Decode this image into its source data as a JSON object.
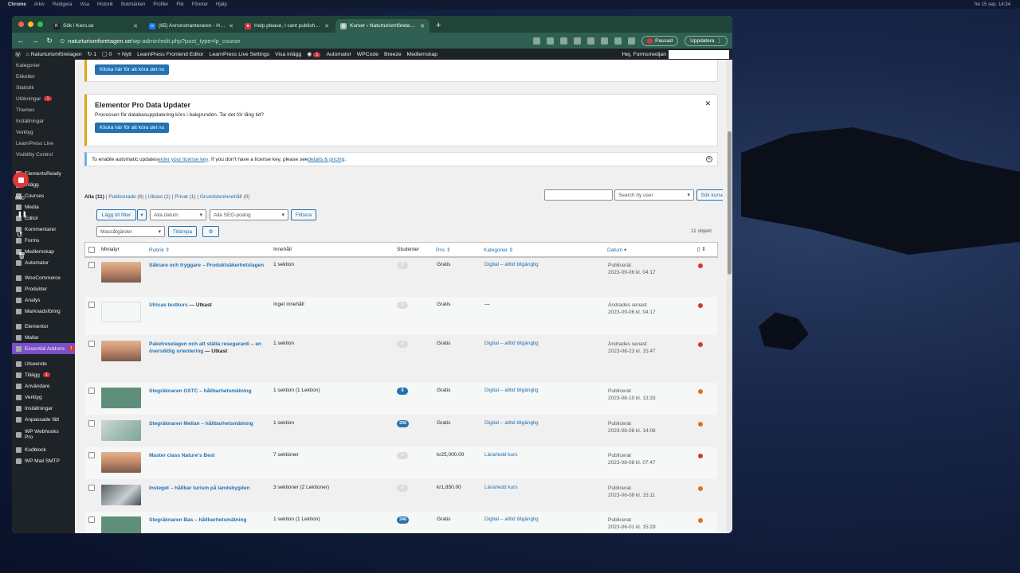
{
  "mac_menu": [
    "Chrome",
    "Arkiv",
    "Redigera",
    "Visa",
    "Historik",
    "Bokmärken",
    "Profiler",
    "Flik",
    "Fönster",
    "Hjälp"
  ],
  "mac_clock": "fre 15 sep. 14:34",
  "tabs": [
    {
      "title": "Sök i Kero.se",
      "icon": "K",
      "color": "#1d2327"
    },
    {
      "title": "(65) Annonshanteraren - Ham",
      "icon": "∞",
      "color": "#1877f2"
    },
    {
      "title": "Help please, I cant publish co",
      "icon": "●",
      "color": "#d63638"
    },
    {
      "title": "Kurser ‹ Naturturismföretagen",
      "icon": "◍",
      "color": "#9fb9b0"
    }
  ],
  "url": {
    "host": "naturturismforetagen.se",
    "path": "/wp-admin/edit.php?post_type=lp_course"
  },
  "browser_buttons": {
    "paused": "Pausad",
    "update": "Uppdatera"
  },
  "adminbar": {
    "site": "Naturturismföretagen",
    "updates": "1",
    "comments": "0",
    "new": "Nytt",
    "items": [
      "LearnPress Frontend Editor",
      "LearnPress Live Settings",
      "Visa inlägg"
    ],
    "notif": "1",
    "items2": [
      "Automator",
      "WPCode",
      "Breeze",
      "Medlemskap"
    ],
    "greeting": "Hej, Formsmedjan"
  },
  "sidebar": {
    "subitems": [
      "Kategorier",
      "Etiketter",
      "Statistik",
      "Utökningar",
      "Themes",
      "Inställningar",
      "Verktyg",
      "LearnPress Live",
      "Visibility Control"
    ],
    "sub_badge": "1",
    "items": [
      "ElementsReady",
      "Inlägg",
      "Courses",
      "Media",
      "Editor",
      "Kommentarer",
      "Forms",
      "Medlemskap",
      "Automator",
      "WooCommerce",
      "Produkter",
      "Analys",
      "Marknadsföring",
      "Elementor",
      "Mallar",
      "Essential Addons",
      "Utseende",
      "Tillägg",
      "Användare",
      "Verktyg",
      "Inställningar",
      "Anpassade fält",
      "WP Webhooks Pro",
      "Kodblock",
      "WP Mail SMTP"
    ],
    "essential_badge": "1",
    "tillagg_badge": "1"
  },
  "recorder": {
    "time": "0:00"
  },
  "notice1": {
    "button": "Klicka här för att köra det nu"
  },
  "notice2": {
    "title": "Elementor Pro Data Updater",
    "text": "Processen för databasuppdatering körs i bakgrunden. Tar det för lång tid?",
    "button": "Klicka här för att köra det nu"
  },
  "license": {
    "pre": "To enable automatic updates ",
    "link1": "enter your license key",
    "mid": ". If you don't have a license key, please see ",
    "link2": "details & pricing",
    "post": "."
  },
  "filters": {
    "all": "Alla",
    "all_count": "(11)",
    "published": "Publicerade",
    "published_count": "(8)",
    "draft": "Utkast",
    "draft_count": "(2)",
    "private": "Privat",
    "private_count": "(1)",
    "drafts_content": "Grundsteninnehåll",
    "drafts_content_count": "(0)"
  },
  "search": {
    "user_placeholder": "Search by user",
    "button": "Sök kurser"
  },
  "toolbar": {
    "add_filter": "Lägg till filter",
    "dates": "Alla datum",
    "seo": "Alla SEO-poäng",
    "filter": "Filtrera",
    "bulk": "Massåtgärder",
    "apply": "Tillämpa",
    "count": "11 objekt"
  },
  "columns": {
    "thumb": "Miniatyr",
    "title": "Rubrik",
    "content": "Innehåll",
    "students": "Studenter",
    "price": "Pris",
    "categories": "Kategorier",
    "date": "Datum"
  },
  "colors": {
    "red": "#d63638",
    "orange": "#e2701f",
    "blue": "#2271b1"
  },
  "rows": [
    {
      "title": "Säkrare och tryggare – Produktsäkerhetslagen",
      "draft": "",
      "content": "1 sektion",
      "students": "0",
      "price": "Gratis",
      "category": "Digital – alltid tillgänglig",
      "date1": "Publicerat",
      "date2": "2023-09-06 kl. 04:17",
      "dot": "red",
      "thumb": "sunset"
    },
    {
      "title": "Ulricas testkurs",
      "draft": " — Utkast",
      "content": "Inget innehåll",
      "students": "0",
      "price": "Gratis",
      "category": "—",
      "date1": "Ändrades senast",
      "date2": "2023-09-06 kl. 04:17",
      "dot": "red",
      "thumb": "empty"
    },
    {
      "title": "Paketreselagen och att ställa resegaranti – en översiktlig orientering",
      "draft": " — Utkast",
      "content": "1 sektion",
      "students": "0",
      "price": "Gratis",
      "category": "Digital – alltid tillgänglig",
      "date1": "Ändrades senast",
      "date2": "2023-08-23 kl. 15:47",
      "dot": "red",
      "thumb": "sunset"
    },
    {
      "title": "Stegräknaren GSTC – hållbarhetsmätning",
      "draft": "",
      "content": "1 sektion (1 Lektion)",
      "students": "9",
      "price": "Gratis",
      "category": "Digital – alltid tillgänglig",
      "date1": "Publicerat",
      "date2": "2023-08-10 kl. 13:33",
      "dot": "orange",
      "thumb": "green"
    },
    {
      "title": "Stegräknaren Mellan – hållbarhetsmätning",
      "draft": "",
      "content": "1 sektion",
      "students": "235",
      "price": "Gratis",
      "category": "Digital – alltid tillgänglig",
      "date1": "Publicerat",
      "date2": "2023-08-08 kl. 14:08",
      "dot": "orange",
      "thumb": "green2"
    },
    {
      "title": "Master class Nature's Best",
      "draft": "",
      "content": "7 sektioner",
      "students": "0",
      "price": "kr25,000.00",
      "category": "Lärarledd kurs",
      "date1": "Publicerat",
      "date2": "2023-08-08 kl. 07:47",
      "dot": "red",
      "thumb": "sunset"
    },
    {
      "title": "Insteget – hållbar turism på landsbygden",
      "draft": "",
      "content": "3 sektioner (2 Lektioner)",
      "students": "0",
      "price": "kr1,850.00",
      "category": "Lärarledd kurs",
      "date1": "Publicerat",
      "date2": "2023-06-08 kl. 15:11",
      "dot": "orange",
      "thumb": "photo"
    },
    {
      "title": "Stegräknaren Bas – hållbarhetsmätning",
      "draft": "",
      "content": "1 sektion (1 Lektion)",
      "students": "240",
      "price": "Gratis",
      "category": "Digital – alltid tillgänglig",
      "date1": "Publicerat",
      "date2": "2023-06-01 kl. 15:29",
      "dot": "orange",
      "thumb": "green"
    }
  ]
}
